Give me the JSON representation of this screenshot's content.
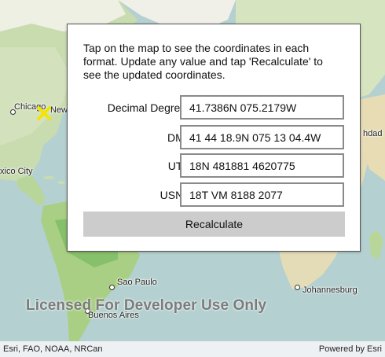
{
  "panel": {
    "instructions": "Tap on the map to see the coordinates in each format. Update any value and tap 'Recalculate' to see the updated coordinates.",
    "fields": [
      {
        "label": "Decimal Degrees:",
        "value": "41.7386N 075.2179W"
      },
      {
        "label": "DMS:",
        "value": "41 44 18.9N 075 13 04.4W"
      },
      {
        "label": "UTM:",
        "value": "18N 481881 4620775"
      },
      {
        "label": "USNG:",
        "value": "18T VM 8188 2077"
      }
    ],
    "recalculate_label": "Recalculate"
  },
  "map": {
    "labels": {
      "chicago": "Chicago",
      "new_york": "New",
      "mexico_city": "xico City",
      "baghdad": "hdad",
      "sao_paulo": "Sao Paulo",
      "buenos_aires": "Buenos Aires",
      "johannesburg": "Johannesburg"
    },
    "watermark": "Licensed For Developer Use Only",
    "marker_color": "#f5e400"
  },
  "attribution": {
    "sources": "Esri, FAO, NOAA, NRCan",
    "powered_by": "Powered by Esri"
  }
}
